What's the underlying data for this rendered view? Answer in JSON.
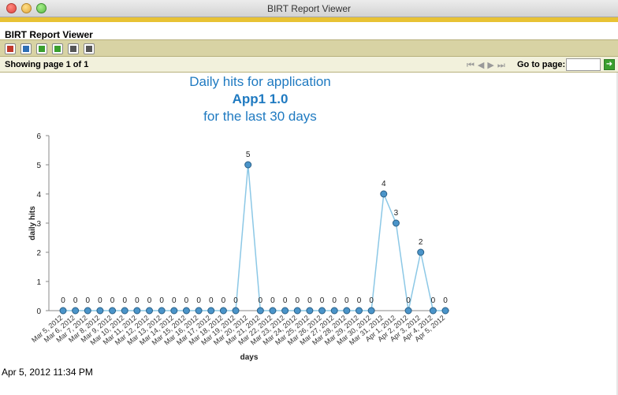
{
  "window": {
    "title": "BIRT Report Viewer"
  },
  "header": {
    "title": "BIRT Report Viewer"
  },
  "toolbar": {
    "buttons": [
      {
        "name": "toc-icon",
        "color": "#c0392b"
      },
      {
        "name": "run-report-icon",
        "color": "#2f6fb5"
      },
      {
        "name": "export-data-icon",
        "color": "#3a9f2e"
      },
      {
        "name": "export-report-icon",
        "color": "#3a9f2e"
      },
      {
        "name": "print-icon",
        "color": "#555555"
      },
      {
        "name": "print-server-icon",
        "color": "#555555"
      }
    ]
  },
  "navbar": {
    "page_info": "Showing page  1  of  1",
    "goto_label": "Go to page:",
    "goto_value": ""
  },
  "report": {
    "title_line1": "Daily hits for application",
    "title_line2": "App1 1.0",
    "title_line3": "for the last 30 days",
    "timestamp": "Apr 5, 2012 11:34 PM"
  },
  "chart_data": {
    "type": "line",
    "xlabel": "days",
    "ylabel": "daily hits",
    "ylim": [
      0,
      6
    ],
    "yticks": [
      0,
      1,
      2,
      3,
      4,
      5,
      6
    ],
    "line_color": "#8cc8e6",
    "marker_color": "#4a94c9",
    "categories": [
      "Mar 5, 2012",
      "Mar 6, 2012",
      "Mar 7, 2012",
      "Mar 8, 2012",
      "Mar 9, 2012",
      "Mar 10, 2012",
      "Mar 11, 2012",
      "Mar 12, 2012",
      "Mar 13, 2012",
      "Mar 14, 2012",
      "Mar 15, 2012",
      "Mar 16, 2012",
      "Mar 17, 2012",
      "Mar 18, 2012",
      "Mar 19, 2012",
      "Mar 20, 2012",
      "Mar 21, 2012",
      "Mar 22, 2012",
      "Mar 23, 2012",
      "Mar 24, 2012",
      "Mar 25, 2012",
      "Mar 26, 2012",
      "Mar 27, 2012",
      "Mar 28, 2012",
      "Mar 29, 2012",
      "Mar 30, 2012",
      "Mar 31, 2012",
      "Apr 1, 2012",
      "Apr 2, 2012",
      "Apr 3, 2012",
      "Apr 4, 2012",
      "Apr 5, 2012"
    ],
    "values": [
      0,
      0,
      0,
      0,
      0,
      0,
      0,
      0,
      0,
      0,
      0,
      0,
      0,
      0,
      0,
      5,
      0,
      0,
      0,
      0,
      0,
      0,
      0,
      0,
      0,
      0,
      4,
      3,
      0,
      2,
      0,
      0
    ]
  }
}
